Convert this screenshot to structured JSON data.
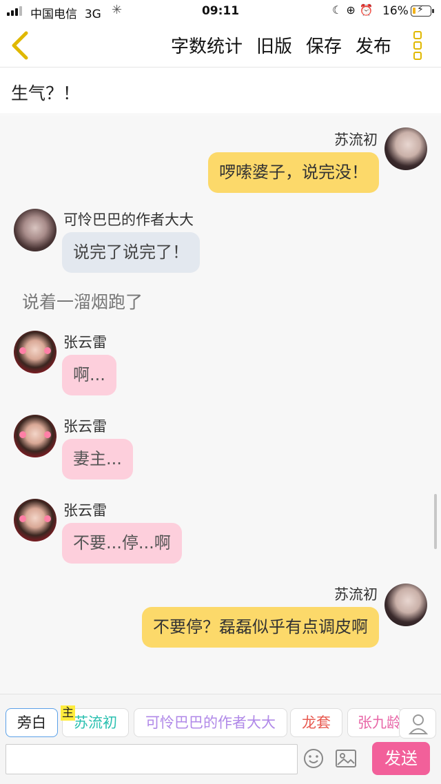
{
  "status_bar": {
    "carrier": "中国电信",
    "network": "3G",
    "time": "09:11",
    "battery": "16%",
    "battery_level": 0.16
  },
  "header": {
    "actions": [
      "字数统计",
      "旧版",
      "保存",
      "发布"
    ]
  },
  "title": "生气？！",
  "messages": [
    {
      "side": "right",
      "name": "苏流初",
      "text": "啰嗦婆子，说完没！",
      "color": "yellow",
      "avatar": "girl-avatar"
    },
    {
      "side": "left",
      "name": "可怜巴巴的作者大大",
      "text": "说完了说完了！",
      "color": "gray",
      "avatar": "author-avatar"
    },
    {
      "type": "narration",
      "text": "说着一溜烟跑了"
    },
    {
      "side": "left",
      "name": "张云雷",
      "text": "啊...",
      "color": "pink",
      "avatar": "zhang-avatar"
    },
    {
      "side": "left",
      "name": "张云雷",
      "text": "妻主...",
      "color": "pink",
      "avatar": "zhang-avatar"
    },
    {
      "side": "left",
      "name": "张云雷",
      "text": "不要...停...啊",
      "color": "pink",
      "avatar": "zhang-avatar"
    },
    {
      "side": "right",
      "name": "苏流初",
      "text": "不要停？磊磊似乎有点调皮啊",
      "color": "yellow",
      "avatar": "girl-avatar"
    }
  ],
  "bottom_bar": {
    "chips": {
      "narration": "旁白",
      "su": "苏流初",
      "host_badge": "主",
      "author": "可怜巴巴的作者大大",
      "long": "龙套",
      "zhang": "张九龄"
    },
    "input_value": "",
    "send_label": "发送"
  },
  "colors": {
    "yellow_bubble": "#fcd96a",
    "gray_bubble": "#e3e8ef",
    "pink_bubble": "#fdcfdc",
    "send_button": "#f2609a",
    "accent_yellow": "#e0b800"
  }
}
